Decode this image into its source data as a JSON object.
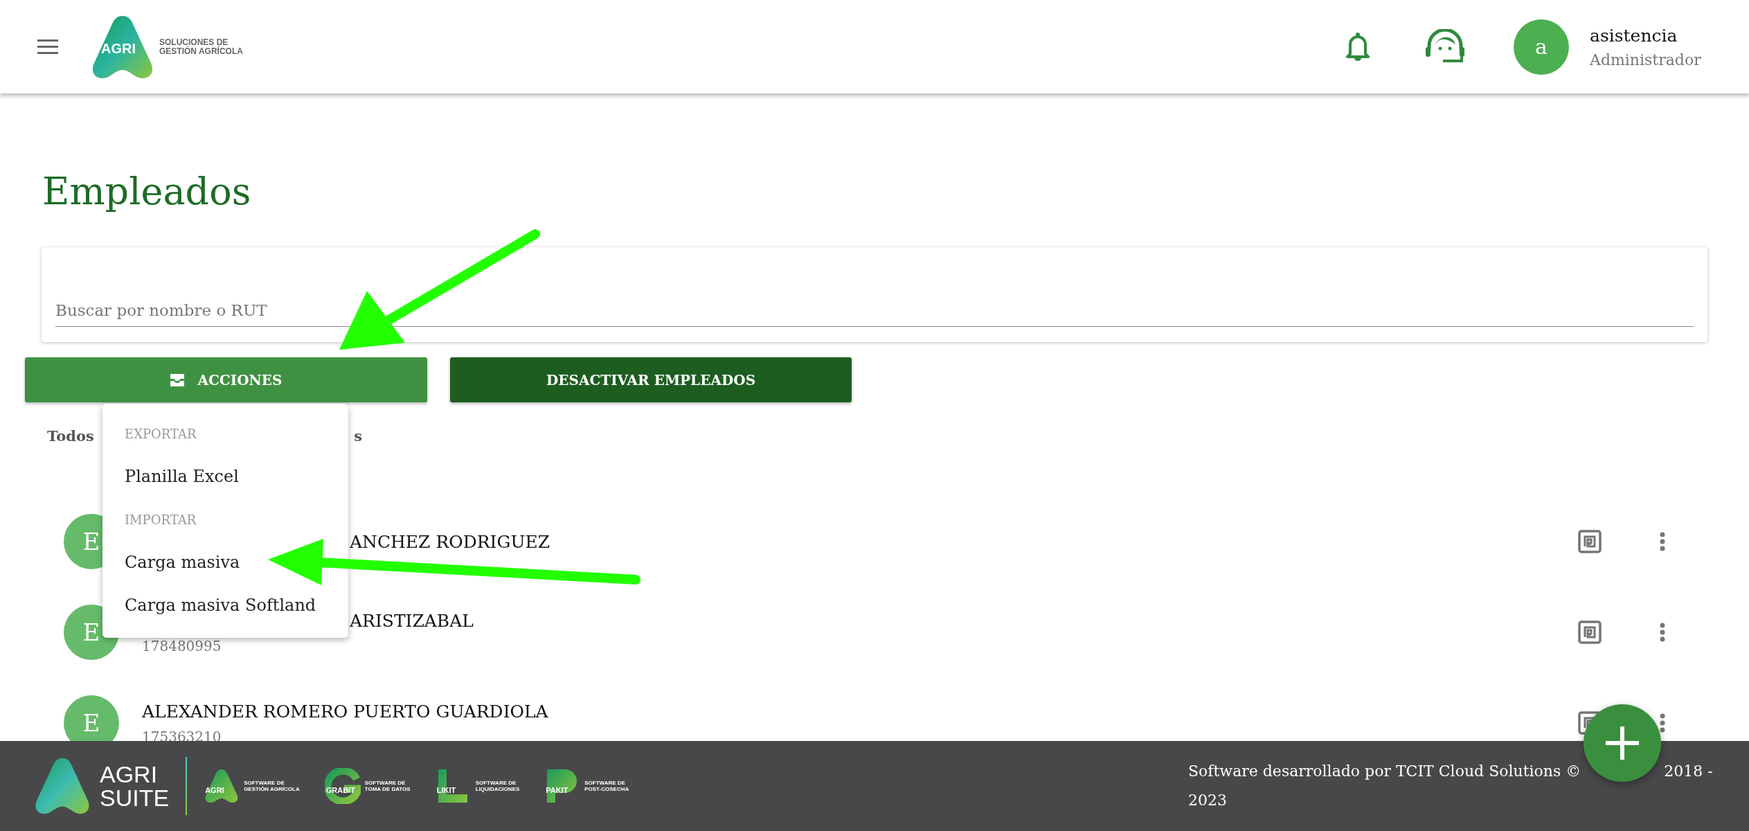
{
  "header": {
    "logo": {
      "mark": "AGRI",
      "tagline_1": "SOLUCIONES DE",
      "tagline_2": "GESTIÓN AGRÍCOLA"
    },
    "user": {
      "initial": "a",
      "name": "asistencia",
      "role": "Administrador"
    }
  },
  "page_title": "Empleados",
  "search": {
    "placeholder": "Buscar por nombre o RUT"
  },
  "buttons": [
    {
      "label": "ACCIONES",
      "kind": "menu"
    },
    {
      "label": "DESACTIVAR EMPLEADOS",
      "kind": "primary"
    }
  ],
  "tabs": [
    {
      "label": "Todos"
    },
    {
      "label": "s"
    }
  ],
  "menu": {
    "items": [
      {
        "kind": "header",
        "label": "EXPORTAR"
      },
      {
        "kind": "item",
        "label": "Planilla Excel"
      },
      {
        "kind": "header",
        "label": "IMPORTAR"
      },
      {
        "kind": "item",
        "label": "Carga masiva"
      },
      {
        "kind": "item",
        "label": "Carga masiva Softland"
      }
    ]
  },
  "employees": [
    {
      "initial": "E",
      "name": "ANCHEZ RODRIGUEZ",
      "covered": true
    },
    {
      "initial": "E",
      "name": "ARISTIZABAL",
      "rut": "178480995",
      "covered": true
    },
    {
      "initial": "E",
      "name": "ALEXANDER ROMERO PUERTO GUARDIOLA",
      "rut": "175363210",
      "covered": false
    }
  ],
  "footer": {
    "suite": {
      "line_1": "AGRI",
      "line_2": "SUITE"
    },
    "products": [
      {
        "kind": "a",
        "mark": "AGRI",
        "line_1": "SOFTWARE DE",
        "line_2": "GESTIÓN AGRÍCOLA"
      },
      {
        "kind": "g",
        "mark": "GRABIT",
        "line_1": "SOFTWARE DE",
        "line_2": "TOMA DE DATOS"
      },
      {
        "kind": "l",
        "mark": "LIKIT",
        "line_1": "SOFTWARE DE",
        "line_2": "LIQUIDACIONES"
      },
      {
        "kind": "p",
        "mark": "PAKIT",
        "line_1": "SOFTWARE DE",
        "line_2": "POST-COSECHA"
      }
    ],
    "credit": "Software desarrollado por TCIT Cloud Solutions ©",
    "years": "2018 - 2023"
  }
}
